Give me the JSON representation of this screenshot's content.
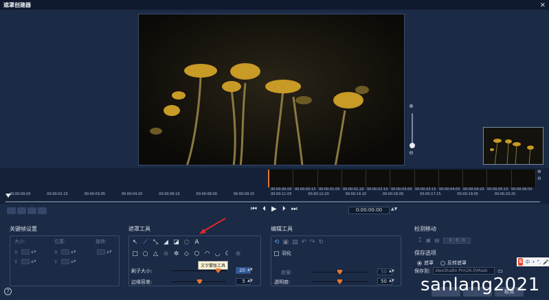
{
  "window": {
    "title": "遮罩创建器",
    "close_glyph": "×"
  },
  "zoom": {
    "in_glyph": "⊕",
    "out_glyph": "⊖",
    "level": 0.15
  },
  "timeline": {
    "zoom_in_glyph": "⊕",
    "zoom_out_glyph": "⊖",
    "ruler_ticks": [
      "00:00:00:00",
      "00:00:01:15",
      "00:00:03:05",
      "00:00:04:20",
      "00:00:06:10",
      "00:00:08:00",
      "00:00:09:15",
      "00:00:11:05",
      "00:00:12:20",
      "00:00:14:10",
      "00:00:16:00",
      "00:00:17:15",
      "00:00:19:05",
      "00:00:20:20"
    ],
    "strip_ticks": [
      "00:00:00:00",
      "00:00:00:15",
      "00:00:01:05",
      "00:00:01:20",
      "00:00:02:10",
      "00:00:03:00",
      "00:00:03:15",
      "00:00:04:05",
      "00:00:04:20",
      "00:00:05:10",
      "00:00:06:00"
    ],
    "end_label": "▶"
  },
  "transport": {
    "start": "⏮",
    "prev": "⏴",
    "play": "▶",
    "next": "⏵",
    "end": "⏭",
    "timecode": "0:00:00:00",
    "spin": "▲▼"
  },
  "keyframe_panel": {
    "title": "关键帧设置",
    "size_label": "大小:",
    "position_label": "位置:",
    "rotation_label": "旋转:",
    "x_label": "X",
    "y_label": "Y",
    "spin": "▲▼"
  },
  "mask_tools": {
    "title": "遮罩工具",
    "row1": [
      "↖",
      "⟋",
      "⤡",
      "◢",
      "◪",
      "◌",
      "A"
    ],
    "row2": [
      "□",
      "○",
      "△",
      "☆",
      "✲",
      "◇",
      "⬡",
      "◠",
      "◡",
      "☾",
      "⊗"
    ],
    "tooltip": "文字蒙版工具",
    "brush_label": "刷子大小:",
    "brush_value": "20",
    "tolerance_label": "边缘容差:",
    "tolerance_value": "5",
    "spin": "▲▼"
  },
  "edit_tools": {
    "title": "编辑工具",
    "icons": [
      "⟲",
      "▣",
      "▤",
      "↶",
      "↷",
      "↻"
    ],
    "feather_label": "羽化",
    "degree_label": "度量:",
    "degree_value": "50",
    "opacity_label": "透明度:",
    "opacity_value": "50",
    "spin": "▲▼"
  },
  "tracking": {
    "title": "检测移动",
    "icons": [
      "⌶",
      "⊞",
      "⊟"
    ],
    "timecode": "0 : 0 : 0"
  },
  "save": {
    "title": "保存选项",
    "mask_label": "遮罩",
    "invert_label": "反转遮罩",
    "save_to_label": "保存到:",
    "path": "ideoStudio Pro\\26.0\\Mask",
    "folder_glyph": "▭"
  },
  "ime": {
    "logo": "S",
    "lang": "中",
    "dot": "•",
    "sep": "°,",
    "mic": "🎤"
  },
  "footer": {
    "help": "?",
    "ok_label": "",
    "cancel_label": "取消"
  },
  "watermark": "sanlang2021"
}
